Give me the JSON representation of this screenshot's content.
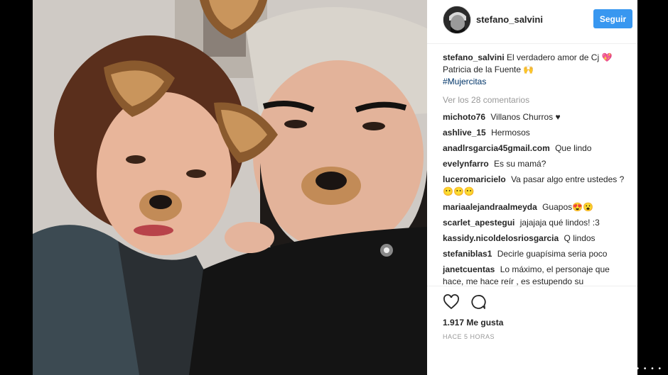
{
  "post": {
    "username": "stefano_salvini",
    "follow_label": "Seguir",
    "caption_text": "El verdadero amor de Cj 💖 Patricia de la Fuente 🙌",
    "hashtag": "#Mujercitas",
    "view_all": "Ver los 28 comentarios",
    "likes": "1.917 Me gusta",
    "time": "HACE 5 HORAS"
  },
  "comments": [
    {
      "user": "michoto76",
      "text": "Villanos Churros ♥"
    },
    {
      "user": "ashlive_15",
      "text": "Hermosos"
    },
    {
      "user": "anadlrsgarcia45gmail.com",
      "text": "Que lindo"
    },
    {
      "user": "evelynfarro",
      "text": "Es su mamá?"
    },
    {
      "user": "luceromaricielo",
      "text": "Va pasar algo entre ustedes ? 😶😶😶"
    },
    {
      "user": "mariaalejandraalmeyda",
      "text": "Guapos😍😮"
    },
    {
      "user": "scarlet_apestegui",
      "text": "jajajaja qué lindos! :3"
    },
    {
      "user": "kassidy.nicoldelosriosgarcia",
      "text": "Q lindos"
    },
    {
      "user": "stefaniblas1",
      "text": "Decirle guapísima seria poco"
    },
    {
      "user": "janetcuentas",
      "text": "Lo máximo, el personaje que hace, me hace reír , es estupendo su"
    }
  ],
  "icons": {
    "like": "heart-icon",
    "comment": "comment-icon"
  },
  "colors": {
    "accent": "#3897f0",
    "hashtag": "#003569",
    "muted": "#999999"
  }
}
